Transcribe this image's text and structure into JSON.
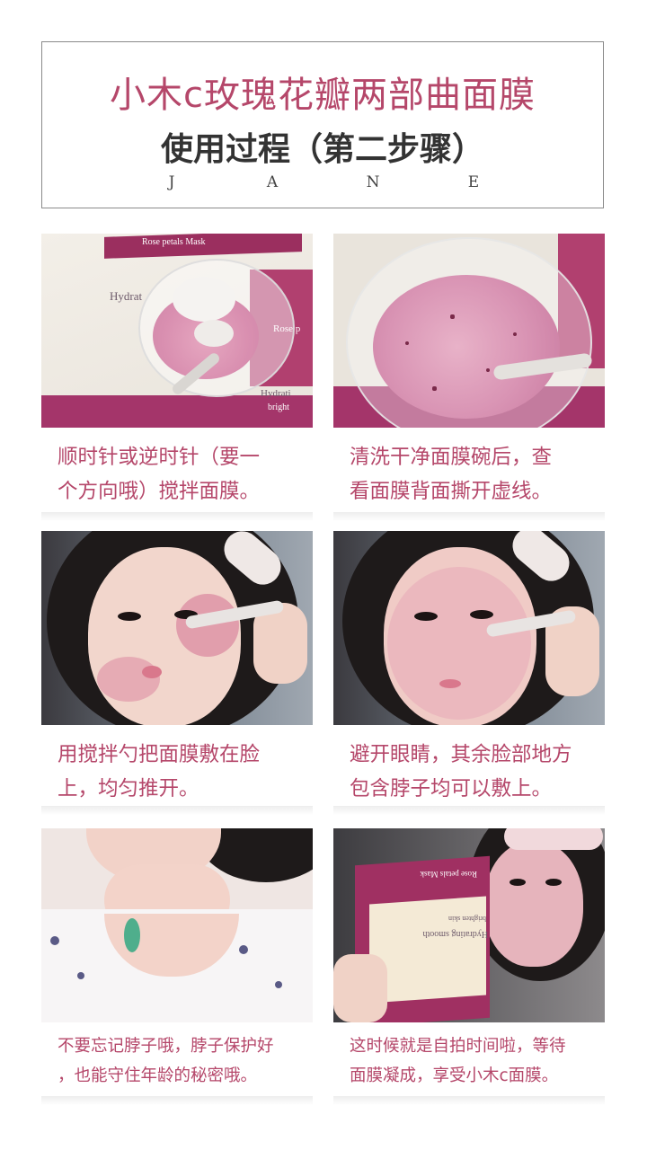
{
  "header": {
    "title": "小木c玫瑰花瓣两部曲面膜",
    "subtitle": "使用过程（第二步骤）",
    "brand_letters": [
      "J",
      "A",
      "N",
      "E"
    ]
  },
  "steps": [
    {
      "caption_line1": "顺时针或逆时针（要一",
      "caption_line2": "个方向哦）搅拌面膜。",
      "photo_text": [
        "Rose petals Mask",
        "Hydrat",
        "Rose p",
        "Hydrati",
        "bright"
      ]
    },
    {
      "caption_line1": "清洗干净面膜碗后，查",
      "caption_line2": "看面膜背面撕开虚线。",
      "photo_text": []
    },
    {
      "caption_line1": "用搅拌勺把面膜敷在脸",
      "caption_line2": "上，均匀推开。",
      "photo_text": []
    },
    {
      "caption_line1": "避开眼睛，其余脸部地方",
      "caption_line2": "包含脖子均可以敷上。",
      "photo_text": []
    },
    {
      "caption_line1": "不要忘记脖子哦，脖子保护好",
      "caption_line2": "，也能守住年龄的秘密哦。",
      "photo_text": []
    },
    {
      "caption_line1": "这时候就是自拍时间啦，等待",
      "caption_line2": "面膜凝成，享受小木c面膜。",
      "photo_text": [
        "Rose petals Mask",
        "Hydrating smooth",
        "brighten skin"
      ]
    }
  ],
  "colors": {
    "accent": "#b5476a",
    "box_magenta": "#9b2f5f",
    "mask_pink": "#d98fb0"
  }
}
